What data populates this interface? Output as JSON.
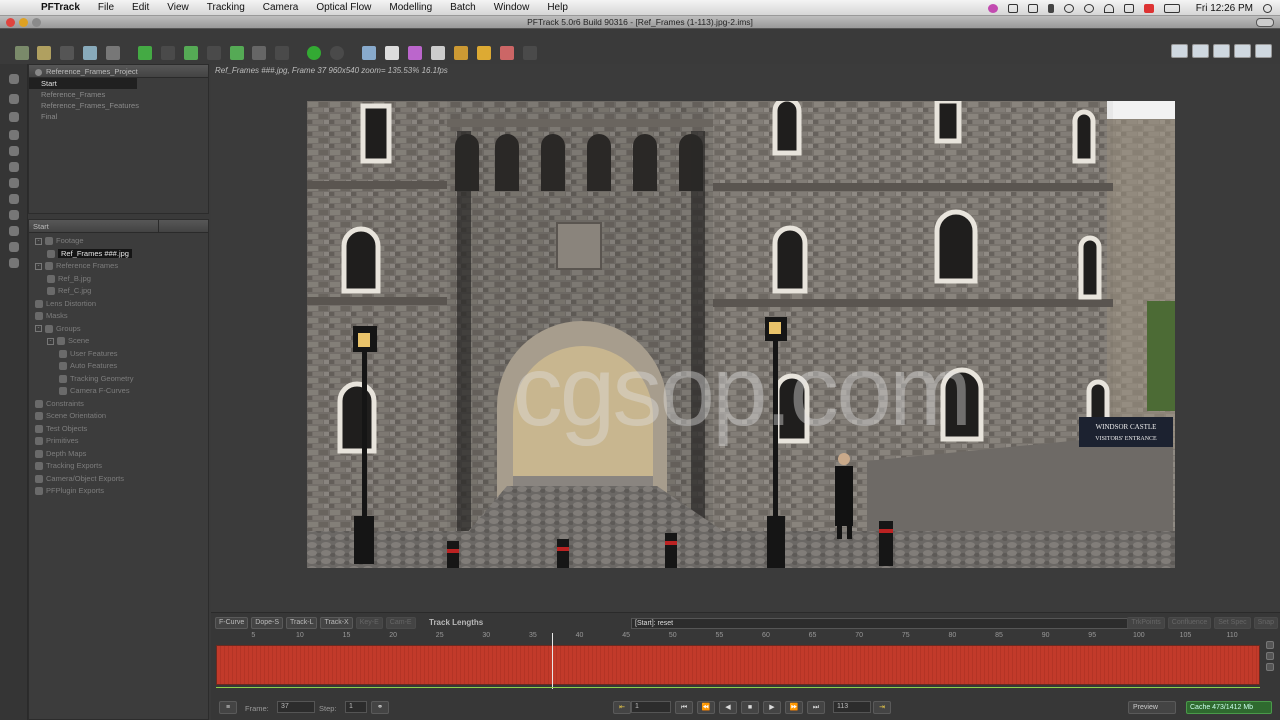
{
  "mac_menubar": {
    "apple_glyph": "",
    "menus": [
      "PFTrack",
      "File",
      "Edit",
      "View",
      "Tracking",
      "Camera",
      "Optical Flow",
      "Modelling",
      "Batch",
      "Window",
      "Help"
    ],
    "clock": "Fri 12:26 PM"
  },
  "window": {
    "title": "PFTrack 5.0r6 Build 90316 - [Ref_Frames (1-113).jpg-2.ims]"
  },
  "project_panel": {
    "tab_label": "Reference_Frames_Project",
    "items": [
      "Start",
      "Reference_Frames",
      "Reference_Frames_Features",
      "Final"
    ],
    "selected_index": 0
  },
  "tree_panel": {
    "header_left": "Start",
    "items": [
      {
        "label": "Footage",
        "indent": 0,
        "expander": "-"
      },
      {
        "label": "Ref_Frames ###.jpg",
        "indent": 1,
        "selected": true
      },
      {
        "label": "Reference Frames",
        "indent": 0,
        "expander": "-"
      },
      {
        "label": "Ref_B.jpg",
        "indent": 1
      },
      {
        "label": "Ref_C.jpg",
        "indent": 1
      },
      {
        "label": "Lens Distortion",
        "indent": 0
      },
      {
        "label": "Masks",
        "indent": 0
      },
      {
        "label": "Groups",
        "indent": 0,
        "expander": "-"
      },
      {
        "label": "Scene",
        "indent": 1,
        "expander": "-"
      },
      {
        "label": "User Features",
        "indent": 2
      },
      {
        "label": "Auto Features",
        "indent": 2
      },
      {
        "label": "Tracking Geometry",
        "indent": 2
      },
      {
        "label": "Camera F-Curves",
        "indent": 2
      },
      {
        "label": "Constraints",
        "indent": 0
      },
      {
        "label": "Scene Orientation",
        "indent": 0
      },
      {
        "label": "Test Objects",
        "indent": 0
      },
      {
        "label": "Primitives",
        "indent": 0
      },
      {
        "label": "Depth Maps",
        "indent": 0
      },
      {
        "label": "Tracking Exports",
        "indent": 0
      },
      {
        "label": "Camera/Object Exports",
        "indent": 0
      },
      {
        "label": "PFPlugin Exports",
        "indent": 0
      }
    ]
  },
  "viewer": {
    "info_line": "Ref_Frames ###.jpg, Frame 37  960x540  zoom= 135.53%  16.1fps",
    "watermark": "cgsop.com",
    "sign_line1": "WINDSOR CASTLE",
    "sign_line2": "VISITORS' ENTRANCE"
  },
  "timeline": {
    "buttons": [
      {
        "label": "F-Curve",
        "enabled": true
      },
      {
        "label": "Dope-S",
        "enabled": true
      },
      {
        "label": "Track-L",
        "enabled": true
      },
      {
        "label": "Track-X",
        "enabled": true
      },
      {
        "label": "Key-E",
        "enabled": false
      },
      {
        "label": "Cam-E",
        "enabled": false
      }
    ],
    "title": "Track Lengths",
    "status": "[Start]: reset",
    "right_buttons": [
      "TrkPoints",
      "Confluence",
      "Set Spec",
      "Snap"
    ],
    "ruler_ticks": [
      5,
      10,
      15,
      20,
      25,
      30,
      35,
      40,
      45,
      50,
      55,
      60,
      65,
      70,
      75,
      80,
      85,
      90,
      95,
      100,
      105,
      110
    ],
    "frame_start": 1,
    "frame_end": 113,
    "current_frame": 37
  },
  "transport": {
    "frame_label": "Frame:",
    "frame_value": "37",
    "step_label": "Step:",
    "step_value": "1",
    "in_frame": "1",
    "out_frame": "113",
    "preview_label": "Preview",
    "cache_label": "Cache 473/1412 Mb"
  },
  "colors": {
    "track_bar": "#c23a2a",
    "cache_green": "#2f6a2f"
  }
}
